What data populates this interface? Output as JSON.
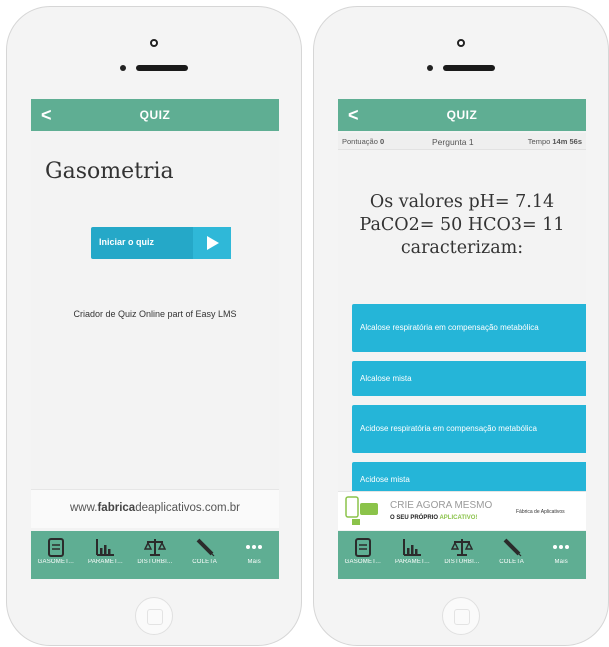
{
  "left": {
    "nav_title": "QUIZ",
    "back_glyph": "<",
    "quiz_title": "Gasometria",
    "start_label": "Iniciar o quiz",
    "creator_text": "Criador de Quiz Online part of Easy LMS",
    "url_prefix": "www.",
    "url_bold": "fabrica",
    "url_mid": "deaplicativos",
    "url_suffix": ".com.br"
  },
  "right": {
    "nav_title": "QUIZ",
    "back_glyph": "<",
    "score_label": "Pontuação",
    "score_value": "0",
    "question_label": "Pergunta 1",
    "time_label": "Tempo",
    "time_value": "14m 56s",
    "question_text": "Os valores pH= 7.14 PaCO2= 50 HCO3= 11 caracterizam:",
    "answers": [
      "Alcalose respiratória em compensação metabólica",
      "Alcalose mista",
      "Acidose respiratória em compensação metabólica",
      "Acidose mista"
    ],
    "ad_line1": "CRIE AGORA MESMO",
    "ad_line2": "O SEU PRÓPRIO",
    "ad_line2_highlight": "APLICATIVO!",
    "ad_brand": "Fábrica de Aplicativos"
  },
  "tabs": [
    {
      "label": "GASOMET...",
      "icon": "clipboard-icon"
    },
    {
      "label": "PARÂMET...",
      "icon": "bar-chart-icon"
    },
    {
      "label": "DISTÚRBI...",
      "icon": "scale-icon"
    },
    {
      "label": "COLETA",
      "icon": "syringe-icon"
    },
    {
      "label": "Mais",
      "icon": "more-icon"
    }
  ],
  "colors": {
    "nav": "#5fae93",
    "button": "#25a8c8",
    "answer": "#25b5d8"
  }
}
